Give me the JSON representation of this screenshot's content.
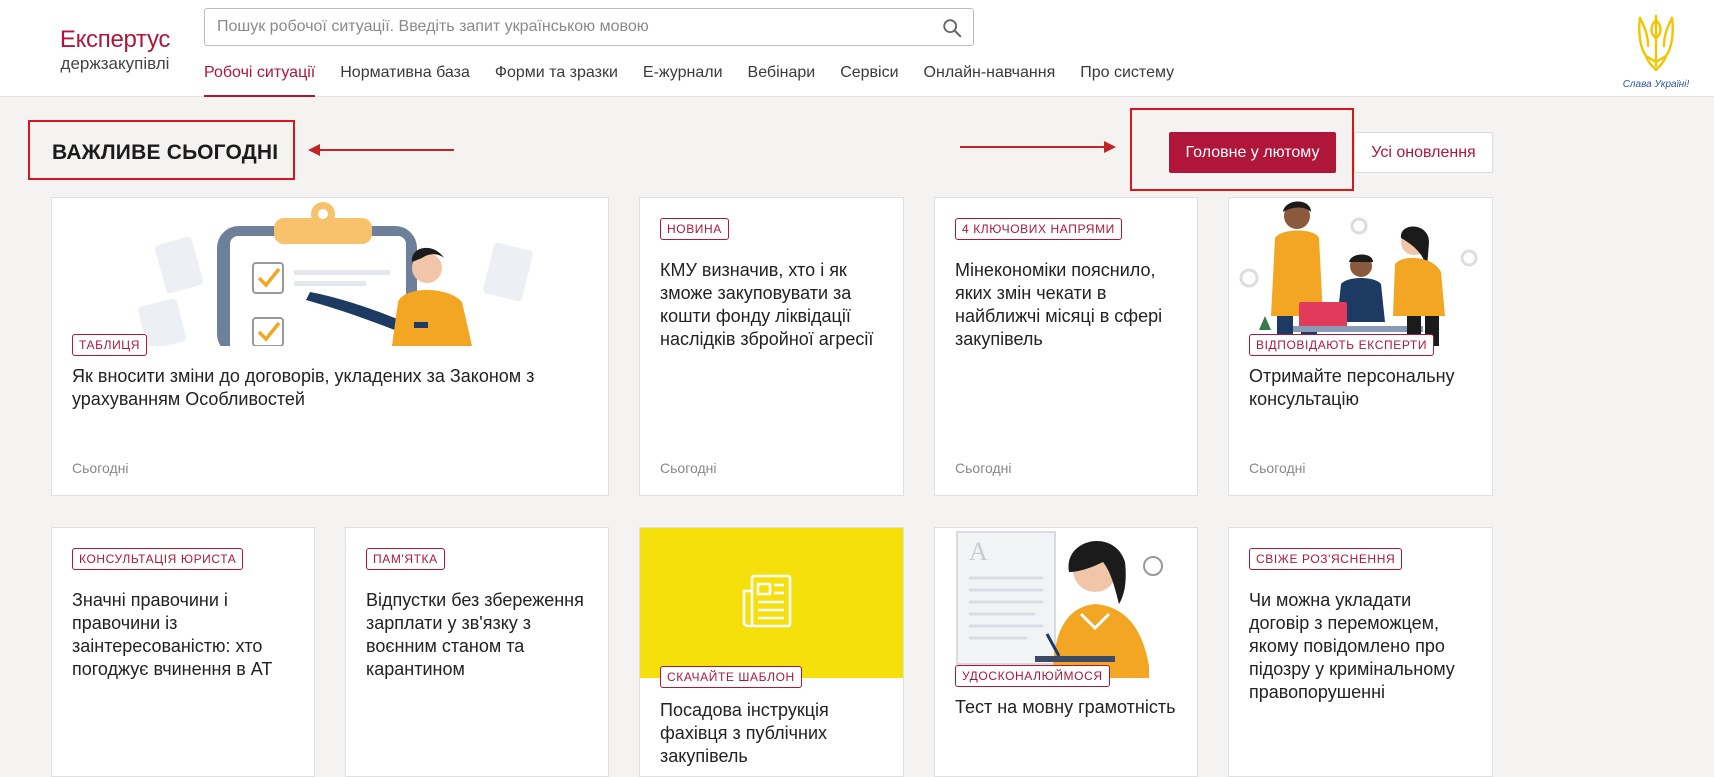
{
  "header": {
    "logo": {
      "main": "Експертус",
      "sub": "держзакупівлі"
    },
    "search": {
      "placeholder": "Пошук робочої ситуації. Введіть запит українською мовою",
      "value": ""
    },
    "nav": [
      {
        "label": "Робочі ситуації",
        "active": true
      },
      {
        "label": "Нормативна база"
      },
      {
        "label": "Форми та зразки"
      },
      {
        "label": "Е-журнали"
      },
      {
        "label": "Вебінари"
      },
      {
        "label": "Сервіси"
      },
      {
        "label": "Онлайн-навчання"
      },
      {
        "label": "Про систему"
      }
    ],
    "emblem_caption": "Слава Україні!"
  },
  "section": {
    "title": "ВАЖЛИВЕ СЬОГОДНІ",
    "primary_button": "Головне у лютому",
    "secondary_button": "Усі оновлення"
  },
  "cards": [
    {
      "tag": "Таблиця",
      "title": "Як вносити зміни до договорів, укладених за Законом з урахуванням Особливостей",
      "date": "Сьогодні",
      "illustration": "clipboard-checklist-illustration"
    },
    {
      "tag": "Новина",
      "title": "КМУ визначив, хто і як зможе закуповувати за кошти фонду ліквідації наслідків збройної агресії",
      "date": "Сьогодні"
    },
    {
      "tag": "4 ключових напрями",
      "title": "Мінекономіки пояснило, яких змін чекати в найближчі місяці в сфері закупівель",
      "date": "Сьогодні"
    },
    {
      "tag": "Відповідають експерти",
      "title": "Отримайте персональну консультацію",
      "date": "Сьогодні",
      "illustration": "experts-team-illustration"
    },
    {
      "tag": "Консультація юриста",
      "title": "Значні правочини і правочини із заінтересованістю: хто погоджує вчинення в АТ"
    },
    {
      "tag": "Пам'ятка",
      "title": "Відпустки без збереження зарплати у зв'язку з воєнним станом та карантином"
    },
    {
      "tag": "Скачайте шаблон",
      "title": "Посадова інструкція фахівця з публічних закупівель",
      "illustration": "document-template-icon"
    },
    {
      "tag": "Удосконалюймося",
      "title": "Тест на мовну грамотність",
      "illustration": "woman-thinking-illustration"
    },
    {
      "tag": "Свіже роз'яснення",
      "title": "Чи можна укладати договір з переможцем, якому повідомлено про підозру у кримінальному правопорушенні"
    }
  ],
  "colors": {
    "brand": "#b0163a",
    "annotation": "#d9161c",
    "yellow": "#f5e00c",
    "orange": "#f2a623"
  }
}
